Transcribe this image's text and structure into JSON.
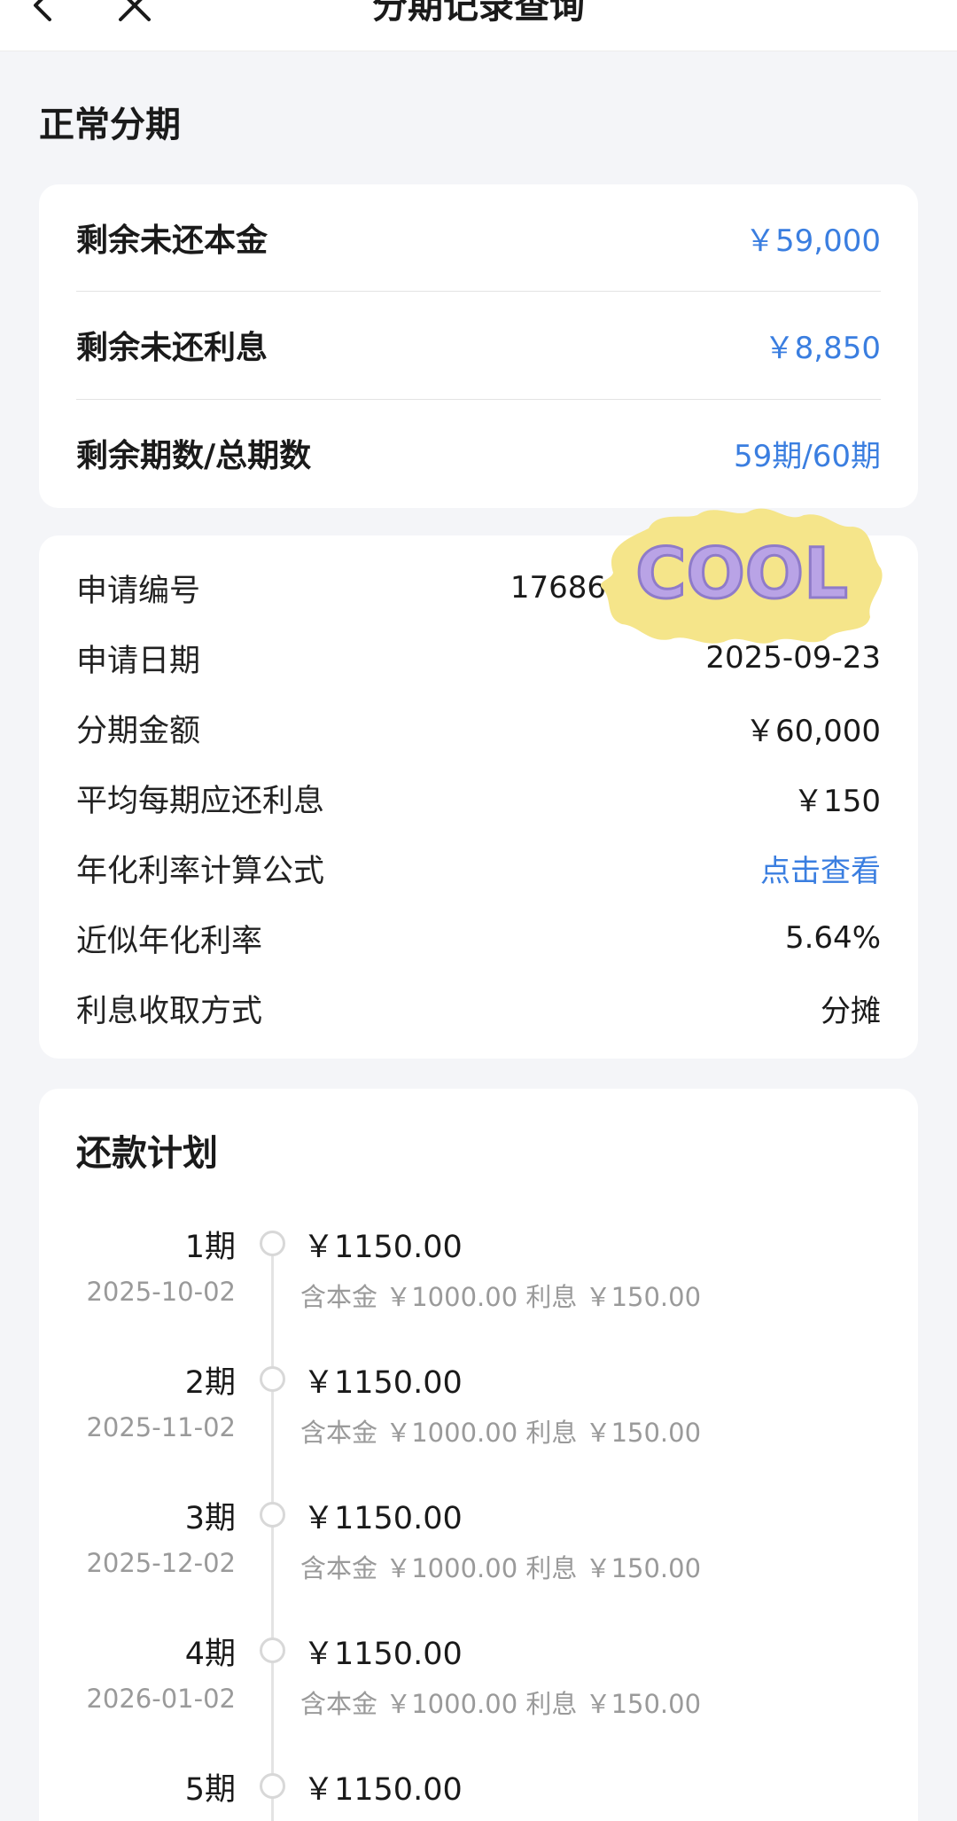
{
  "nav": {
    "title": "分期记录查询"
  },
  "section_title": "正常分期",
  "summary": [
    {
      "label": "剩余未还本金",
      "value": "￥59,000"
    },
    {
      "label": "剩余未还利息",
      "value": "￥8,850"
    },
    {
      "label": "剩余期数/总期数",
      "value": "59期/60期"
    }
  ],
  "info": [
    {
      "label": "申请编号",
      "value": "17686",
      "link": false
    },
    {
      "label": "申请日期",
      "value": "2025-09-23",
      "link": false
    },
    {
      "label": "分期金额",
      "value": "￥60,000",
      "link": false
    },
    {
      "label": "平均每期应还利息",
      "value": "￥150",
      "link": false
    },
    {
      "label": "年化利率计算公式",
      "value": "点击查看",
      "link": true
    },
    {
      "label": "近似年化利率",
      "value": "5.64%",
      "link": false
    },
    {
      "label": "利息收取方式",
      "value": "分摊",
      "link": false
    }
  ],
  "sticker_text": "COOL",
  "plan": {
    "title": "还款计划",
    "items": [
      {
        "period": "1期",
        "date": "2025-10-02",
        "amount": "￥1150.00",
        "detail": "含本金 ￥1000.00 利息 ￥150.00"
      },
      {
        "period": "2期",
        "date": "2025-11-02",
        "amount": "￥1150.00",
        "detail": "含本金 ￥1000.00 利息 ￥150.00"
      },
      {
        "period": "3期",
        "date": "2025-12-02",
        "amount": "￥1150.00",
        "detail": "含本金 ￥1000.00 利息 ￥150.00"
      },
      {
        "period": "4期",
        "date": "2026-01-02",
        "amount": "￥1150.00",
        "detail": "含本金 ￥1000.00 利息 ￥150.00"
      },
      {
        "period": "5期",
        "date": "",
        "amount": "￥1150.00",
        "detail": ""
      }
    ]
  },
  "colors": {
    "accent": "#3a7ee0",
    "muted": "#9a9a9a",
    "background": "#f4f5f8"
  }
}
